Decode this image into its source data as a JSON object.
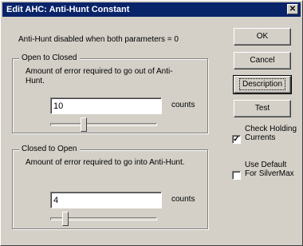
{
  "window": {
    "title": "Edit AHC: Anti-Hunt Constant",
    "close_glyph": "✕"
  },
  "note": "Anti-Hunt disabled when both parameters = 0",
  "groups": [
    {
      "legend": "Open to Closed",
      "description": "Amount of error required to go out of Anti-Hunt.",
      "value": "10",
      "units": "counts",
      "slider_fraction": 0.3
    },
    {
      "legend": "Closed to Open",
      "description": "Amount of error required to go into Anti-Hunt.",
      "value": "4",
      "units": "counts",
      "slider_fraction": 0.12
    }
  ],
  "buttons": {
    "ok": "OK",
    "cancel": "Cancel",
    "description": "Description",
    "test": "Test"
  },
  "checkboxes": [
    {
      "label": "Check Holding Currents",
      "checked": true,
      "mark": "✓"
    },
    {
      "label": "Use Default For SilverMax",
      "checked": false,
      "mark": ""
    }
  ],
  "colors": {
    "title_bar": "#0a246a",
    "face": "#d4d0c8"
  }
}
